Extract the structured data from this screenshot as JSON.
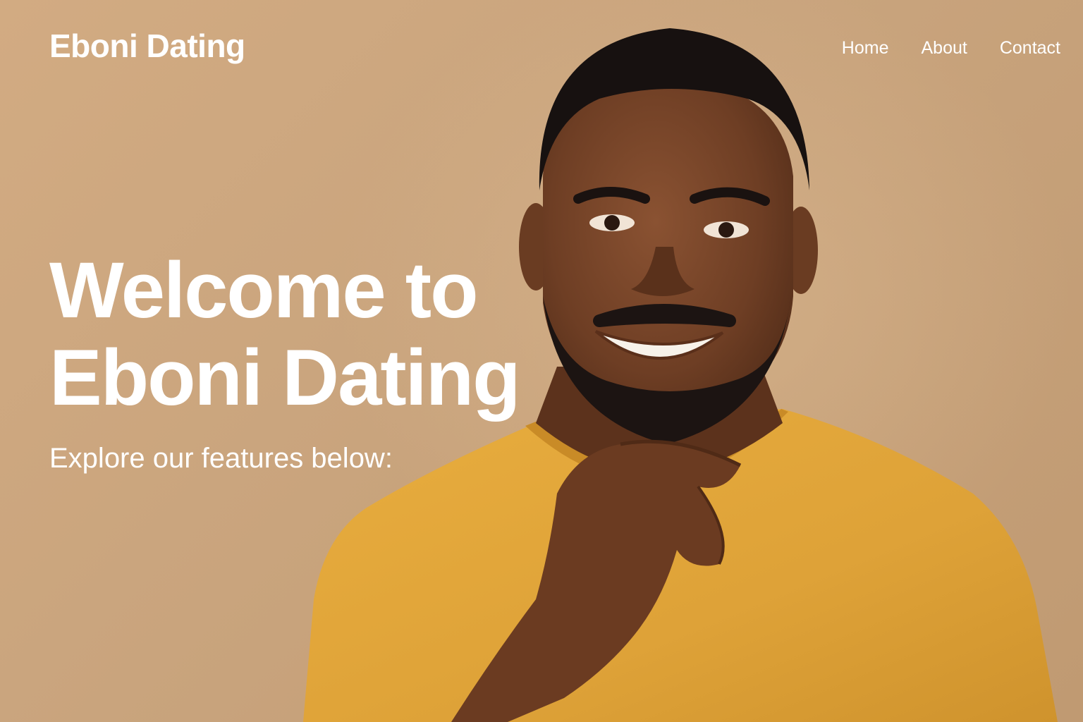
{
  "header": {
    "brand": "Eboni Dating",
    "nav": [
      {
        "label": "Home"
      },
      {
        "label": "About"
      },
      {
        "label": "Contact"
      }
    ]
  },
  "hero": {
    "headline_line1": "Welcome to",
    "headline_line2": "Eboni Dating",
    "subtitle": "Explore our features below:"
  },
  "colors": {
    "background": "#cfa87f",
    "shirt": "#e0a63a",
    "text": "#ffffff"
  }
}
